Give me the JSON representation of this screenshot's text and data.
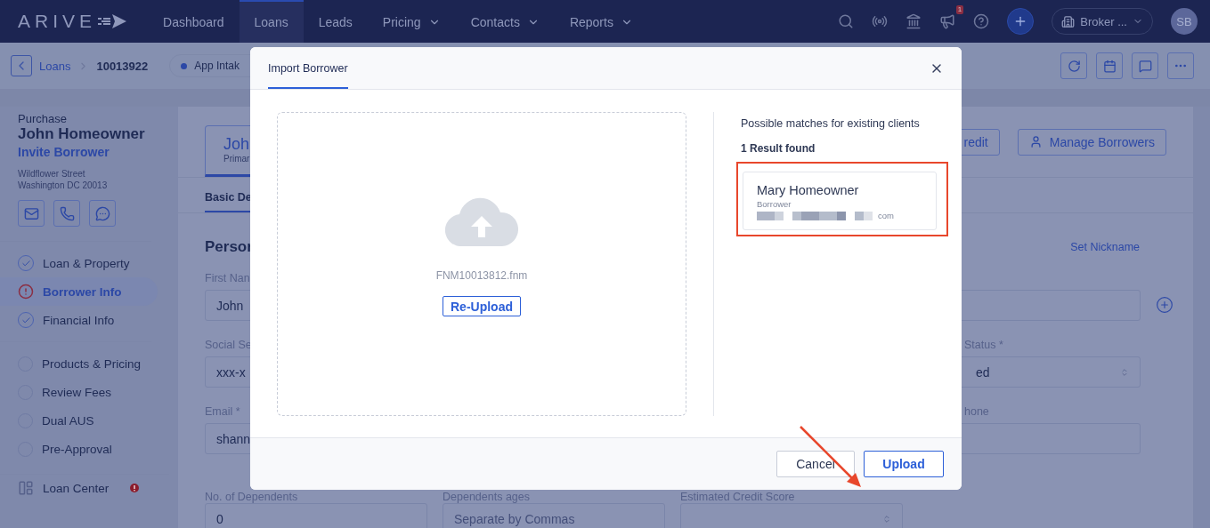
{
  "topbar": {
    "logo": "ARIVE",
    "nav": [
      {
        "label": "Dashboard",
        "selected": false,
        "dropdown": false
      },
      {
        "label": "Loans",
        "selected": true,
        "dropdown": false
      },
      {
        "label": "Leads",
        "selected": false,
        "dropdown": false
      },
      {
        "label": "Pricing",
        "selected": false,
        "dropdown": true
      },
      {
        "label": "Contacts",
        "selected": false,
        "dropdown": true
      },
      {
        "label": "Reports",
        "selected": false,
        "dropdown": true
      }
    ],
    "notification_count": "1",
    "workspace": "Broker ...",
    "avatar": "SB"
  },
  "breadcrumb": {
    "items": [
      "Loans",
      "10013922"
    ],
    "status": "App Intak"
  },
  "sidebar": {
    "loan_type": "Purchase",
    "borrower": "John Homeowner",
    "invite": "Invite Borrower",
    "address": [
      "Wildflower Street",
      "Washington DC 20013"
    ],
    "step_groups": [
      [
        {
          "label": "Loan & Property",
          "kind": "done",
          "selected": false
        },
        {
          "label": "Borrower Info",
          "kind": "error",
          "selected": true
        },
        {
          "label": "Financial Info",
          "kind": "done",
          "selected": false
        }
      ],
      [
        {
          "label": "Products & Pricing",
          "kind": "todo",
          "selected": false
        },
        {
          "label": "Review Fees",
          "kind": "todo",
          "selected": false
        },
        {
          "label": "Dual AUS",
          "kind": "todo",
          "selected": false
        },
        {
          "label": "Pre-Approval",
          "kind": "todo",
          "selected": false
        }
      ]
    ],
    "loan_center": {
      "label": "Loan Center",
      "alert": true
    }
  },
  "main": {
    "borrower_tab": {
      "name": "Joh",
      "role": "Primar"
    },
    "actions": [
      "redit",
      "Manage Borrowers"
    ],
    "tab": "Basic De",
    "section_title": "Persor",
    "nickname_link": "Set Nickname",
    "form_rows": [
      {
        "column_1": {
          "label": "First Nan",
          "value": "John"
        },
        "column_4": {
          "add_button": true
        }
      },
      {
        "column_1": {
          "label": "Social Se",
          "value": "xxx-x"
        },
        "column_4": {
          "label": "Status *",
          "value": "ed",
          "dropdown": true
        }
      },
      {
        "column_1": {
          "label": "Email *",
          "value": "shann"
        },
        "column_4": {
          "label": "hone"
        }
      },
      {
        "column_1": {
          "label": "No. of Dependents",
          "value": "0"
        },
        "column_2": {
          "label": "Dependents ages",
          "placeholder": "Separate by Commas"
        },
        "column_3": {
          "label": "Estimated Credit Score",
          "dropdown": true
        }
      }
    ]
  },
  "modal": {
    "title": "Import Borrower",
    "file_name": "FNM10013812.fnm",
    "reupload": "Re-Upload",
    "matches_heading": "Possible matches for existing clients",
    "result_count": "1 Result found",
    "matches": [
      {
        "name": "Mary Homeowner",
        "role": "Borrower",
        "email_end": "com",
        "highlighted": true
      }
    ],
    "buttons": [
      {
        "label": "Cancel",
        "kind": "secondary"
      },
      {
        "label": "Upload",
        "kind": "primary"
      }
    ]
  }
}
